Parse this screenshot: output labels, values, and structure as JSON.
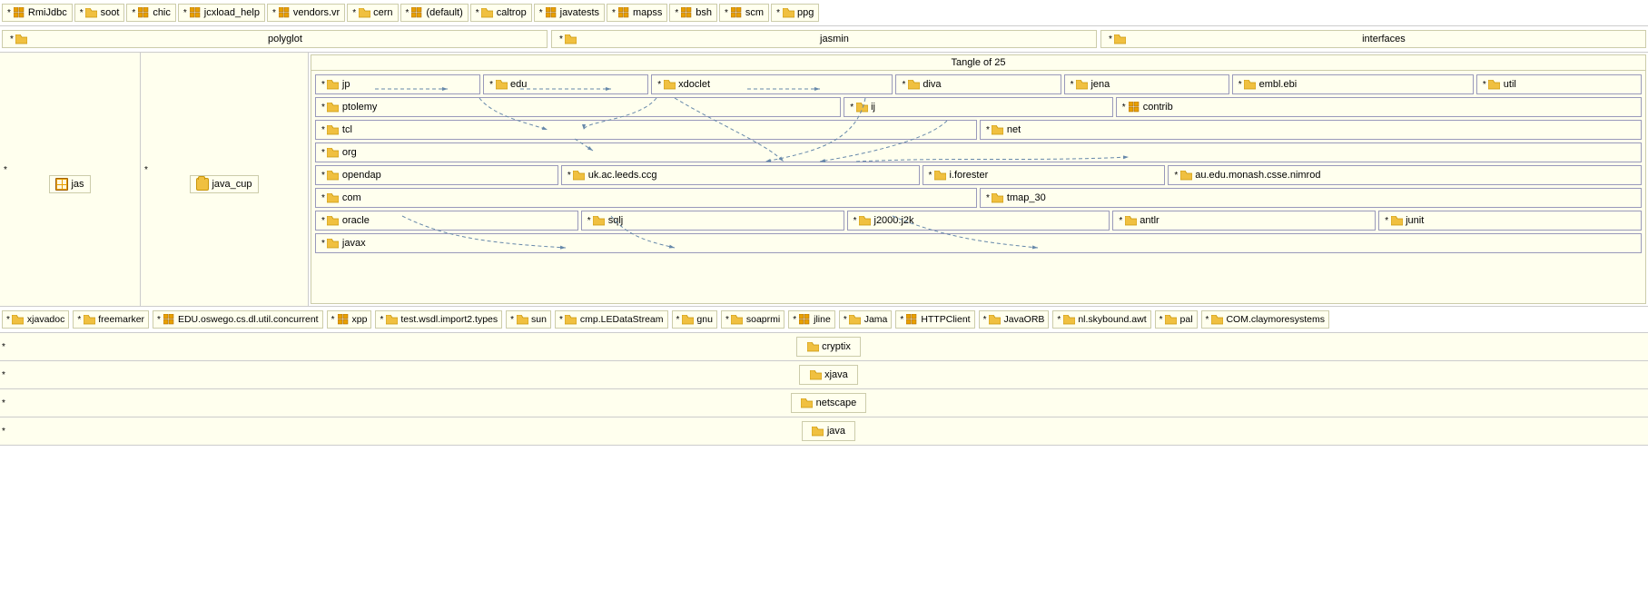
{
  "top_row": {
    "items": [
      {
        "star": "*",
        "icon": "grid",
        "label": "RmiJdbc"
      },
      {
        "star": "*",
        "icon": "folder",
        "label": "soot"
      },
      {
        "star": "*",
        "icon": "grid",
        "label": "chic"
      },
      {
        "star": "*",
        "icon": "grid",
        "label": "jcxload_help"
      },
      {
        "star": "*",
        "icon": "grid",
        "label": "vendors.vr"
      },
      {
        "star": "*",
        "icon": "folder",
        "label": "cern"
      },
      {
        "star": "*",
        "icon": "grid",
        "label": "(default)"
      },
      {
        "star": "*",
        "icon": "folder",
        "label": "caltrop"
      },
      {
        "star": "*",
        "icon": "grid",
        "label": "javatests"
      },
      {
        "star": "*",
        "icon": "grid",
        "label": "mapss"
      },
      {
        "star": "*",
        "icon": "grid",
        "label": "bsh"
      },
      {
        "star": "*",
        "icon": "grid",
        "label": "scm"
      },
      {
        "star": "*",
        "icon": "folder",
        "label": "ppg"
      }
    ]
  },
  "second_row": {
    "items": [
      {
        "star": "*",
        "icon": "folder",
        "label": "polyglot"
      },
      {
        "star": "*",
        "icon": "folder",
        "label": "jasmin"
      },
      {
        "star": "*",
        "icon": "folder",
        "label": "interfaces"
      }
    ]
  },
  "left_panel": {
    "star": "*",
    "icon": "grid",
    "label": "jas"
  },
  "middle_panel": {
    "star": "*",
    "icon": "folder",
    "label": "java_cup"
  },
  "tangle": {
    "title": "Tangle of 25",
    "rows": [
      {
        "cells": [
          {
            "star": "*",
            "icon": "folder",
            "label": "jp",
            "flex": 1
          },
          {
            "star": "*",
            "icon": "folder",
            "label": "edu",
            "flex": 1
          },
          {
            "star": "*",
            "icon": "folder",
            "label": "xdoclet",
            "flex": 1.5
          },
          {
            "star": "*",
            "icon": "folder",
            "label": "diva",
            "flex": 1
          },
          {
            "star": "*",
            "icon": "folder",
            "label": "jena",
            "flex": 1
          },
          {
            "star": "*",
            "icon": "folder",
            "label": "embl.ebi",
            "flex": 1.5
          },
          {
            "star": "*",
            "icon": "folder",
            "label": "util",
            "flex": 1
          }
        ]
      },
      {
        "cells": [
          {
            "star": "*",
            "icon": "folder",
            "label": "ptolemy",
            "flex": 3
          },
          {
            "star": "*",
            "icon": "folder",
            "label": "ij",
            "flex": 1.5
          },
          {
            "star": "*",
            "icon": "grid",
            "label": "contrib",
            "flex": 3
          }
        ]
      },
      {
        "cells": [
          {
            "star": "*",
            "icon": "folder",
            "label": "tcl",
            "flex": 3
          },
          {
            "star": "*",
            "icon": "folder",
            "label": "net",
            "flex": 3
          }
        ]
      },
      {
        "cells": [
          {
            "star": "*",
            "icon": "folder",
            "label": "org",
            "flex": 6
          }
        ]
      },
      {
        "cells": [
          {
            "star": "*",
            "icon": "folder",
            "label": "opendap",
            "flex": 1
          },
          {
            "star": "*",
            "icon": "folder",
            "label": "uk.ac.leeds.ccg",
            "flex": 1.5
          },
          {
            "star": "*",
            "icon": "folder",
            "label": "i.forester",
            "flex": 1
          },
          {
            "star": "*",
            "icon": "folder",
            "label": "au.edu.monash.csse.nimrod",
            "flex": 2
          }
        ]
      },
      {
        "cells": [
          {
            "star": "*",
            "icon": "folder",
            "label": "com",
            "flex": 3
          },
          {
            "star": "*",
            "icon": "folder",
            "label": "tmap_30",
            "flex": 3
          }
        ]
      },
      {
        "cells": [
          {
            "star": "*",
            "icon": "folder",
            "label": "oracle",
            "flex": 1
          },
          {
            "star": "*",
            "icon": "folder",
            "label": "sqlj",
            "flex": 1
          },
          {
            "star": "*",
            "icon": "folder",
            "label": "j2000.j2k",
            "flex": 1
          },
          {
            "star": "*",
            "icon": "folder",
            "label": "antlr",
            "flex": 1
          },
          {
            "star": "*",
            "icon": "folder",
            "label": "junit",
            "flex": 1
          }
        ]
      },
      {
        "cells": [
          {
            "star": "*",
            "icon": "folder",
            "label": "javax",
            "flex": 6
          }
        ]
      }
    ]
  },
  "bottom_packages": {
    "items": [
      {
        "star": "*",
        "icon": "folder",
        "label": "xjavadoc"
      },
      {
        "star": "*",
        "icon": "folder",
        "label": "freemarker"
      },
      {
        "star": "*",
        "icon": "grid",
        "label": "EDU.oswego.cs.dl.util.concurrent"
      },
      {
        "star": "*",
        "icon": "grid",
        "label": "xpp"
      },
      {
        "star": "*",
        "icon": "folder",
        "label": "test.wsdl.import2.types"
      },
      {
        "star": "*",
        "icon": "folder",
        "label": "sun"
      },
      {
        "star": "*",
        "icon": "folder",
        "label": "cmp.LEDataStream"
      },
      {
        "star": "*",
        "icon": "folder",
        "label": "gnu"
      },
      {
        "star": "*",
        "icon": "folder",
        "label": "soaprmi"
      },
      {
        "star": "*",
        "icon": "grid",
        "label": "jline"
      },
      {
        "star": "*",
        "icon": "folder",
        "label": "Jama"
      },
      {
        "star": "*",
        "icon": "grid",
        "label": "HTTPClient"
      },
      {
        "star": "*",
        "icon": "folder",
        "label": "JavaORB"
      },
      {
        "star": "*",
        "icon": "folder",
        "label": "nl.skybound.awt"
      },
      {
        "star": "*",
        "icon": "folder",
        "label": "pal"
      },
      {
        "star": "*",
        "icon": "folder",
        "label": "COM.claymoresystems"
      }
    ]
  },
  "single_rows": [
    {
      "star": "*",
      "icon": "folder",
      "label": "cryptix"
    },
    {
      "star": "*",
      "icon": "folder",
      "label": "xjava"
    },
    {
      "star": "*",
      "icon": "folder",
      "label": "netscape"
    },
    {
      "star": "*",
      "icon": "folder",
      "label": "java"
    }
  ]
}
